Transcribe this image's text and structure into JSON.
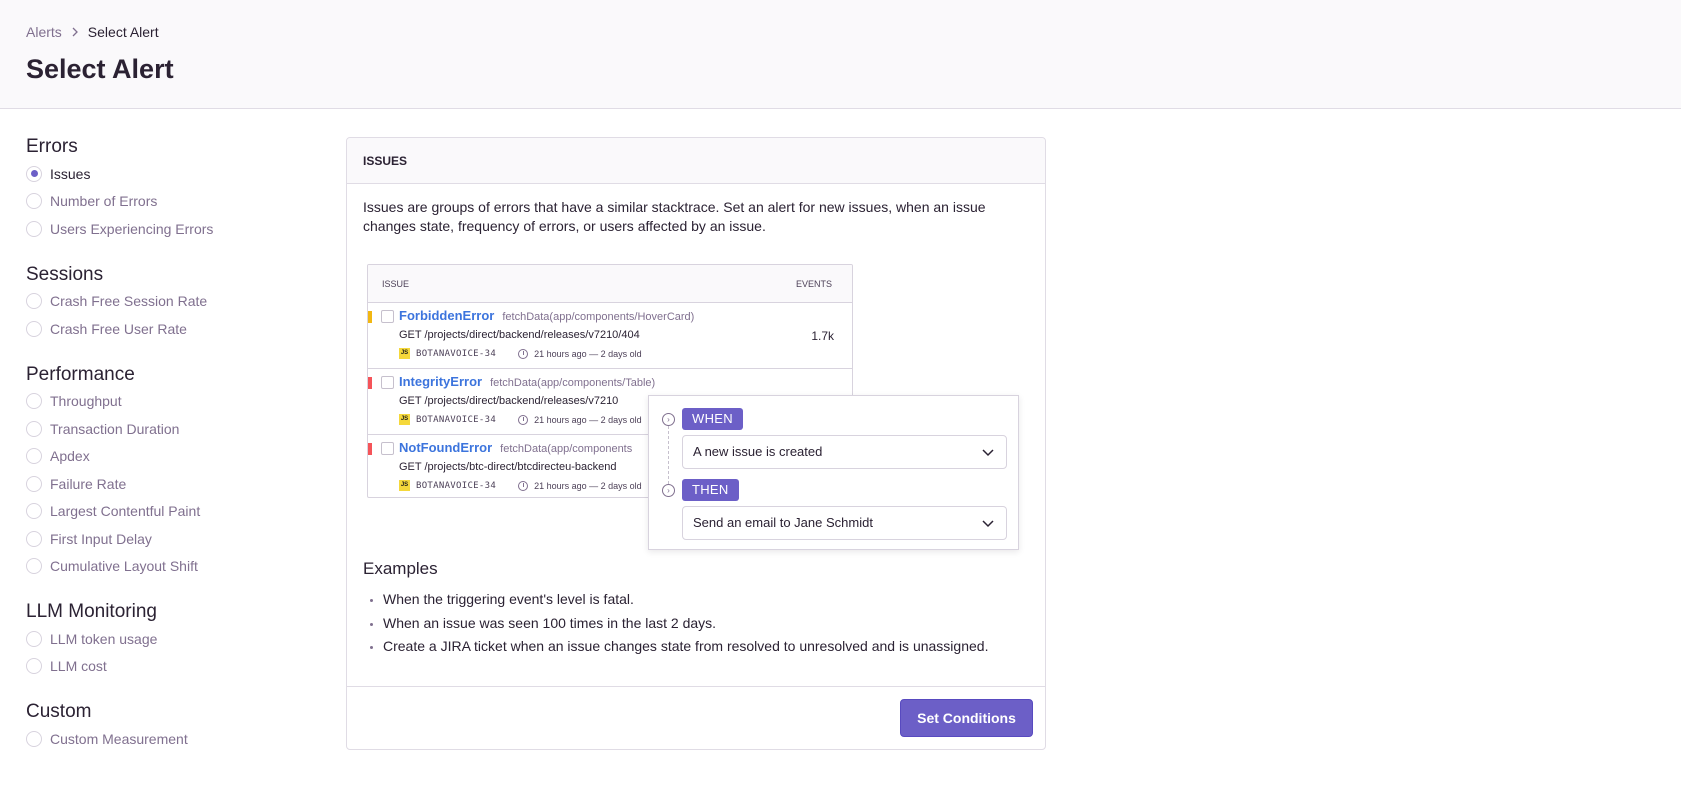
{
  "header": {
    "breadcrumb": {
      "parent": "Alerts",
      "current": "Select Alert"
    },
    "title": "Select Alert"
  },
  "sidebar": {
    "groups": [
      {
        "title": "Errors",
        "options": [
          "Issues",
          "Number of Errors",
          "Users Experiencing Errors"
        ]
      },
      {
        "title": "Sessions",
        "options": [
          "Crash Free Session Rate",
          "Crash Free User Rate"
        ]
      },
      {
        "title": "Performance",
        "options": [
          "Throughput",
          "Transaction Duration",
          "Apdex",
          "Failure Rate",
          "Largest Contentful Paint",
          "First Input Delay",
          "Cumulative Layout Shift"
        ]
      },
      {
        "title": "LLM Monitoring",
        "options": [
          "LLM token usage",
          "LLM cost"
        ]
      },
      {
        "title": "Custom",
        "options": [
          "Custom Measurement"
        ]
      }
    ],
    "selected": "Issues"
  },
  "card": {
    "header": "ISSUES",
    "description": "Issues are groups of errors that have a similar stacktrace. Set an alert for new issues, when an issue changes state, frequency of errors, or users affected by an issue.",
    "illustration": {
      "columns": {
        "issue": "ISSUE",
        "events": "EVENTS"
      },
      "rows": [
        {
          "title": "ForbiddenError",
          "culprit": "fetchData(app/components/HoverCard)",
          "message": "GET /projects/direct/backend/releases/v7210/404",
          "short_id": "BOTANAVOICE-34",
          "time": "21 hours ago — 2 days old",
          "events": "1.7k",
          "level_color": "#f2b712"
        },
        {
          "title": "IntegrityError",
          "culprit": "fetchData(app/components/Table)",
          "message": "GET /projects/direct/backend/releases/v7210",
          "short_id": "BOTANAVOICE-34",
          "time": "21 hours ago — 2 days old",
          "events": "",
          "level_color": "#f55459"
        },
        {
          "title": "NotFoundError",
          "culprit": "fetchData(app/components",
          "message": "GET /projects/btc-direct/btcdirecteu-backend",
          "short_id": "BOTANAVOICE-34",
          "time": "21 hours ago — 2 days old",
          "events": "",
          "level_color": "#f55459"
        }
      ],
      "js_badge": "JS",
      "when_label": "WHEN",
      "when_value": "A new issue is created",
      "then_label": "THEN",
      "then_value": "Send an email to Jane Schmidt"
    },
    "examples_title": "Examples",
    "examples": [
      "When the triggering event's level is fatal.",
      "When an issue was seen 100 times in the last 2 days.",
      "Create a JIRA ticket when an issue changes state from resolved to unresolved and is unassigned."
    ],
    "set_conditions": "Set Conditions"
  },
  "colors": {
    "accent": "#6c5fc7",
    "link": "#3c74dd",
    "muted": "#80708f"
  },
  "icons": [
    "chevron-right-icon",
    "radio-icon",
    "checkbox-icon",
    "js-platform-icon",
    "clock-icon",
    "step-icon",
    "chevron-down-icon"
  ]
}
